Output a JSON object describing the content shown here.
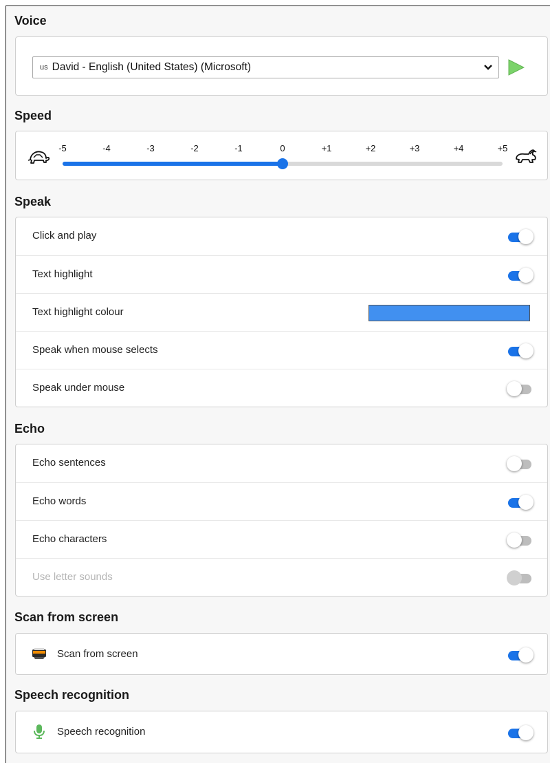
{
  "sections": {
    "voice": {
      "title": "Voice",
      "flag": "us",
      "selected_voice": "David - English (United States) (Microsoft)"
    },
    "speed": {
      "title": "Speed",
      "ticks": [
        "-5",
        "-4",
        "-3",
        "-2",
        "-1",
        "0",
        "+1",
        "+2",
        "+3",
        "+4",
        "+5"
      ],
      "value": 0,
      "min": -5,
      "max": 5
    },
    "speak": {
      "title": "Speak",
      "rows": [
        {
          "label": "Click and play",
          "state": "on"
        },
        {
          "label": "Text highlight",
          "state": "on"
        },
        {
          "label": "Text highlight colour",
          "swatch": "#4190f0"
        },
        {
          "label": "Speak when mouse selects",
          "state": "on"
        },
        {
          "label": "Speak under mouse",
          "state": "off"
        }
      ]
    },
    "echo": {
      "title": "Echo",
      "rows": [
        {
          "label": "Echo sentences",
          "state": "off"
        },
        {
          "label": "Echo words",
          "state": "on"
        },
        {
          "label": "Echo characters",
          "state": "off"
        },
        {
          "label": "Use letter sounds",
          "state": "disabled"
        }
      ]
    },
    "scan": {
      "title": "Scan from screen",
      "row": {
        "label": "Scan from screen",
        "icon": "scanner-icon",
        "state": "on"
      }
    },
    "speech": {
      "title": "Speech recognition",
      "row": {
        "label": "Speech recognition",
        "icon": "microphone-icon",
        "state": "on"
      }
    }
  },
  "colors": {
    "accent": "#1a73e8",
    "toggle_off": "#bdbdbd",
    "highlight_colour": "#4190f0"
  }
}
